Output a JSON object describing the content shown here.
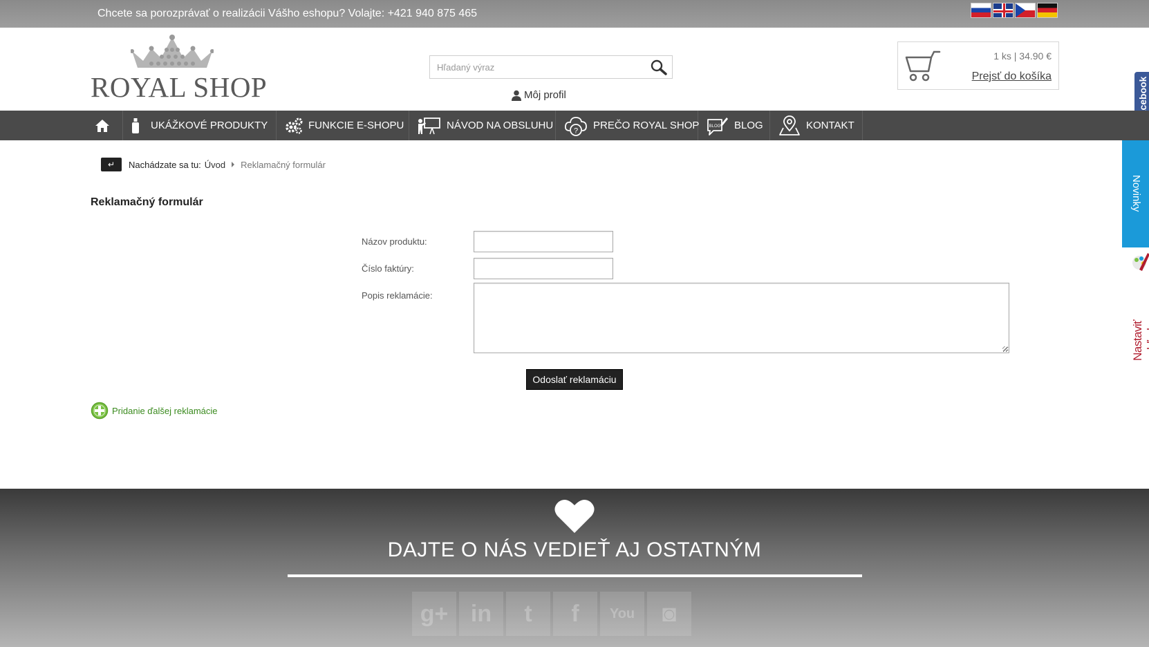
{
  "topbar": {
    "message": "Chcete sa porozprávať o realizácii Vášho eshopu? Volajte: +421 940 875 465",
    "flags": [
      "sk-flag-icon",
      "en-flag-icon",
      "cz-flag-icon",
      "de-flag-icon"
    ]
  },
  "header": {
    "logo_text": "ROYAL SHOP",
    "search_placeholder": "Hľadaný výraz",
    "profile_label": "Môj profil",
    "cart_summary": "1 ks | 34.90 €",
    "cart_link": "Prejsť do košíka"
  },
  "nav": {
    "items": [
      {
        "label": "UKÁŽKOVÉ PRODUKTY",
        "icon": "bottle-icon"
      },
      {
        "label": "FUNKCIE E-SHOPU",
        "icon": "gears-icon"
      },
      {
        "label": "NÁVOD NA OBSLUHU",
        "icon": "presentation-icon"
      },
      {
        "label": "PREČO ROYAL SHOP",
        "icon": "question-cloud-icon"
      },
      {
        "label": "BLOG",
        "icon": "blog-icon"
      },
      {
        "label": "KONTAKT",
        "icon": "map-pin-icon"
      }
    ]
  },
  "side_tabs": {
    "facebook": "facebook",
    "novinky": "Novinky",
    "nastavit": "Nastaviť vzhľad"
  },
  "breadcrumb": {
    "label": "Nachádzate sa tu:",
    "home": "Úvod",
    "current": "Reklamačný formulár"
  },
  "page": {
    "title": "Reklamačný formulár",
    "form": {
      "product_label": "Názov produktu:",
      "invoice_label": "Číslo faktúry:",
      "description_label": "Popis reklamácie:",
      "submit_label": "Odoslať reklamáciu"
    },
    "add_more": "Pridanie ďalšej reklamácie"
  },
  "footer": {
    "title": "DAJTE O NÁS VEDIEŤ AJ OSTATNÝM",
    "socials": [
      {
        "name": "google-plus-icon",
        "glyph": "g+"
      },
      {
        "name": "linkedin-icon",
        "glyph": "in"
      },
      {
        "name": "twitter-icon",
        "glyph": "t"
      },
      {
        "name": "facebook-icon",
        "glyph": "f"
      },
      {
        "name": "youtube-icon",
        "glyph": "You"
      },
      {
        "name": "instagram-icon",
        "glyph": "◙"
      }
    ]
  },
  "colors": {
    "topbar": "#8a8a8a",
    "nav": "#4a4a4a",
    "novinky": "#1b9ad9",
    "facebook": "#3b5998",
    "add_link": "#3a8a1e"
  }
}
